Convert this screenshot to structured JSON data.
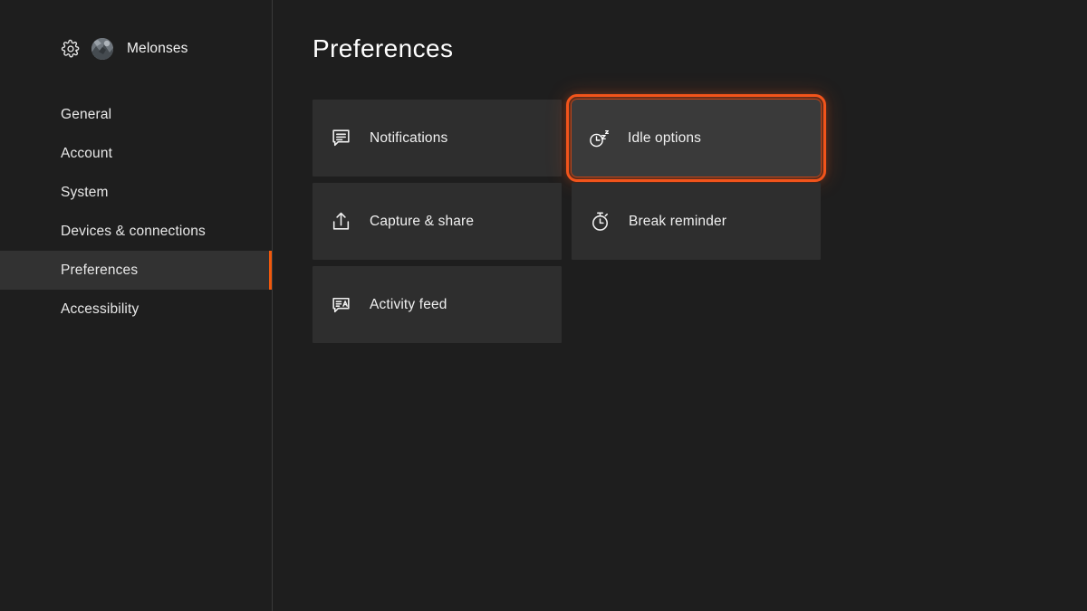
{
  "account": {
    "gear_icon": "gear-icon",
    "avatar_icon": "avatar-image",
    "name": "Melonses"
  },
  "sidebar": {
    "items": [
      {
        "label": "General",
        "selected": false
      },
      {
        "label": "Account",
        "selected": false
      },
      {
        "label": "System",
        "selected": false
      },
      {
        "label": "Devices & connections",
        "selected": false
      },
      {
        "label": "Preferences",
        "selected": true
      },
      {
        "label": "Accessibility",
        "selected": false
      }
    ]
  },
  "main": {
    "title": "Preferences",
    "tiles": [
      {
        "label": "Notifications",
        "icon": "message-lines-icon",
        "focused": false
      },
      {
        "label": "Idle options",
        "icon": "clock-sleep-icon",
        "focused": true
      },
      {
        "label": "Capture & share",
        "icon": "upload-share-icon",
        "focused": false
      },
      {
        "label": "Break reminder",
        "icon": "stopwatch-icon",
        "focused": false
      },
      {
        "label": "Activity feed",
        "icon": "activity-feed-icon",
        "focused": false
      }
    ]
  },
  "colors": {
    "background": "#1e1e1e",
    "tile": "#2e2e2e",
    "tile_focused": "#3a3a3a",
    "selected_row": "#323232",
    "accent": "#f0580c",
    "focus_ring": "#f2541b",
    "divider": "#3b3b3b",
    "text": "#f0f0f0"
  }
}
